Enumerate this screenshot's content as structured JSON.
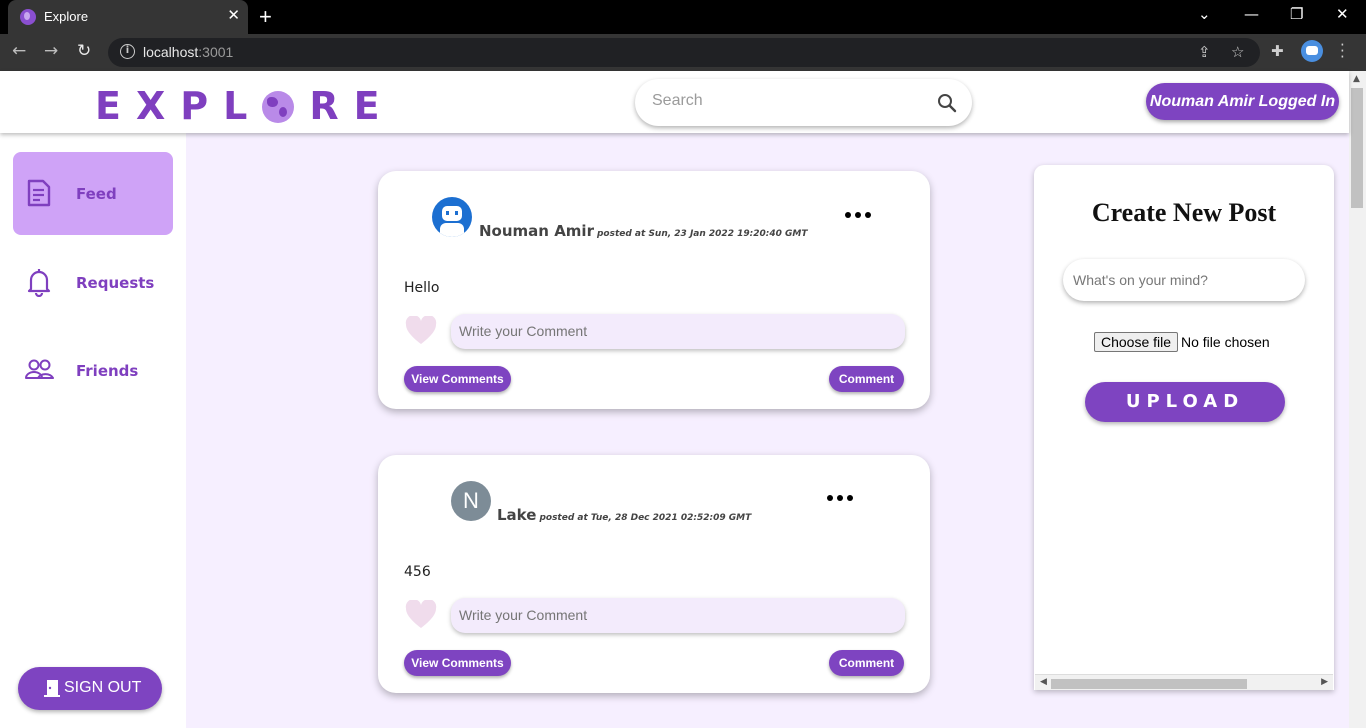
{
  "browser": {
    "tab_title": "Explore",
    "tab_close": "✕",
    "new_tab": "+",
    "url_host": "localhost",
    "url_port": ":3001"
  },
  "header": {
    "logo_left": "EXPL",
    "logo_right": "RE",
    "search_placeholder": "Search",
    "user_badge": "Nouman Amir Logged In"
  },
  "sidebar": {
    "items": [
      {
        "label": "Feed",
        "icon": "document-icon",
        "active": true
      },
      {
        "label": "Requests",
        "icon": "bell-icon",
        "active": false
      },
      {
        "label": "Friends",
        "icon": "people-icon",
        "active": false
      }
    ],
    "signout_label": "SIGN OUT"
  },
  "posts": [
    {
      "author": "Nouman Amir",
      "posted": "posted at Sun, 23 Jan 2022 19:20:40 GMT",
      "avatar": "robot-avatar",
      "body": "Hello",
      "comment_placeholder": "Write your Comment",
      "view_comments": "View Comments",
      "comment_button": "Comment"
    },
    {
      "author": "Lake",
      "posted": "posted at Tue, 28 Dec 2021 02:52:09 GMT",
      "avatar_letter": "N",
      "body": "456",
      "comment_placeholder": "Write your Comment",
      "view_comments": "View Comments",
      "comment_button": "Comment"
    }
  ],
  "create_post": {
    "title": "Create New Post",
    "placeholder": "What's on your mind?",
    "file_button": "Choose file",
    "file_status": "No file chosen",
    "upload_label": "UPLOAD"
  },
  "colors": {
    "brand": "#7e44c1",
    "active_nav": "#cfa3f7",
    "page_bg": "#f6efff"
  }
}
